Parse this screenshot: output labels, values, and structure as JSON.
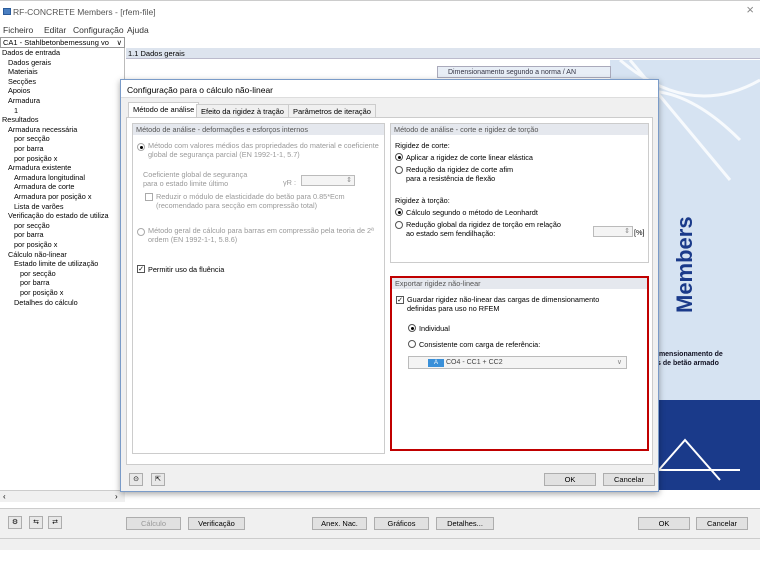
{
  "window": {
    "title": "RF-CONCRETE Members - [rfem-file]",
    "close": "×"
  },
  "menu": [
    "Ficheiro",
    "Editar",
    "Configuração",
    "Ajuda"
  ],
  "module_select": "CA1 - Stahlbetonbemessung vo",
  "tree": [
    {
      "label": "Dados de entrada",
      "indent": 0
    },
    {
      "label": "Dados gerais",
      "indent": 1
    },
    {
      "label": "Materiais",
      "indent": 1
    },
    {
      "label": "Secções",
      "indent": 1
    },
    {
      "label": "Apoios",
      "indent": 1
    },
    {
      "label": "Armadura",
      "indent": 1
    },
    {
      "label": "1",
      "indent": 2
    },
    {
      "label": "Resultados",
      "indent": 0
    },
    {
      "label": "Armadura necessária",
      "indent": 1
    },
    {
      "label": "por secção",
      "indent": 2
    },
    {
      "label": "por barra",
      "indent": 2
    },
    {
      "label": "por posição x",
      "indent": 2
    },
    {
      "label": "Armadura existente",
      "indent": 1
    },
    {
      "label": "Armadura longitudinal",
      "indent": 2
    },
    {
      "label": "Armadura de corte",
      "indent": 2
    },
    {
      "label": "Armadura por posição x",
      "indent": 2
    },
    {
      "label": "Lista de varões",
      "indent": 2
    },
    {
      "label": "Verificação do estado de utiliza",
      "indent": 1
    },
    {
      "label": "por secção",
      "indent": 2
    },
    {
      "label": "por barra",
      "indent": 2
    },
    {
      "label": "por posição x",
      "indent": 2
    },
    {
      "label": "Cálculo não-linear",
      "indent": 1
    },
    {
      "label": "Estado limite de utilização",
      "indent": 2
    },
    {
      "label": "por secção",
      "indent": 3
    },
    {
      "label": "por barra",
      "indent": 3
    },
    {
      "label": "por posição x",
      "indent": 3
    },
    {
      "label": "Detalhes do cálculo",
      "indent": 2
    }
  ],
  "main": {
    "header": "1.1 Dados gerais",
    "norm": "Dimensionamento segundo a norma / AN",
    "brand": "Members",
    "brand_sub1": "imensionamento de",
    "brand_sub2": "s de betão armado"
  },
  "dialog": {
    "title": "Configuração para o cálculo não-linear",
    "tabs": [
      "Método de análise",
      "Efeito da rigidez à tração",
      "Parâmetros de iteração"
    ],
    "left": {
      "head": "Método de análise - deformações e esforços internos",
      "opt1a": "Método com valores médios das propriedades do material e coeficiente",
      "opt1b": "global de segurança parcial (EN 1992-1-1, 5.7)",
      "coef1": "Coeficiente global de segurança",
      "coef2": "para o estado limite último",
      "gr": "γR :",
      "red1": "Reduzir o módulo de elasticidade do betão para 0.85*Ecm",
      "red2": "(recomendado para secção em compressão total)",
      "opt2a": "Método geral de cálculo para barras em compressão pela teoria de 2ª",
      "opt2b": "ordem (EN 1992-1-1, 5.8.6)",
      "creep": "Permitir uso da fluência"
    },
    "right": {
      "head": "Método de análise - corte e rigidez de torção",
      "shear": "Rigidez de corte:",
      "s1": "Aplicar a rigidez de corte linear elástica",
      "s2a": "Redução da rigidez de corte afim",
      "s2b": "para a resistência de flexão",
      "tors": "Rigidez à torção:",
      "t1": "Cálculo segundo o método de Leonhardt",
      "t2a": "Redução global da rigidez de torção em relação",
      "t2b": "ao estado sem fendilhação:",
      "unit": "[%]"
    },
    "export": {
      "head": "Exportar rigidez não-linear",
      "save1": "Guardar rigidez não-linear das cargas de dimensionamento",
      "save2": "definidas para uso no RFEM",
      "individual": "Individual",
      "consistent": "Consistente com carga de referência:",
      "combo_badge": "A",
      "combo": "CO4 - CC1 + CC2"
    },
    "ok": "OK",
    "cancel": "Cancelar"
  },
  "bottom": {
    "calc": "Cálculo",
    "verif": "Verificação",
    "anex": "Anex. Nac.",
    "graf": "Gráficos",
    "det": "Detalhes...",
    "ok": "OK",
    "cancel": "Cancelar"
  },
  "colors": {
    "accent": "#c00000",
    "brand": "#1a3a8a"
  }
}
